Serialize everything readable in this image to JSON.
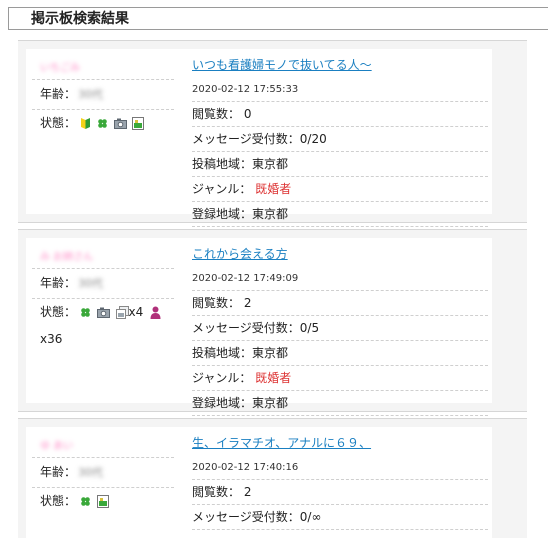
{
  "page_title": "掲示板検索結果",
  "labels": {
    "age": "年齢：",
    "status": "状態：",
    "views": "閲覧数：",
    "messages": "メッセージ受付数：",
    "post_area": "投稿地域：",
    "genre": "ジャンル：",
    "reg_area": "登録地域："
  },
  "posts": [
    {
      "nickname": "いちごみ",
      "age": "30代",
      "title": "いつも看護婦モノで抜いてる人～",
      "datetime": "2020-02-12 17:55:33",
      "views": "0",
      "messages": "0/20",
      "post_area": "東京都",
      "genre": "既婚者",
      "reg_area": "東京都",
      "status_icons": [
        "beginner-icon",
        "clover-icon",
        "camera-icon",
        "photo-icon"
      ]
    },
    {
      "nickname": "み お姉さん",
      "age": "30代",
      "title": "これから会える方",
      "datetime": "2020-02-12 17:49:09",
      "views": "2",
      "messages": "0/5",
      "post_area": "東京都",
      "genre": "既婚者",
      "reg_area": "東京都",
      "status_icons": [
        "clover-icon",
        "camera-icon",
        "multi-photo-icon",
        "person-icon"
      ],
      "photo_count": "x4",
      "person_count": "x36"
    },
    {
      "nickname": "ゆ あい",
      "age": "30代",
      "title": "生、イラマチオ、アナルに６９、",
      "datetime": "2020-02-12 17:40:16",
      "views": "2",
      "messages": "0/∞",
      "status_icons": [
        "clover-icon",
        "photo-icon"
      ]
    }
  ]
}
